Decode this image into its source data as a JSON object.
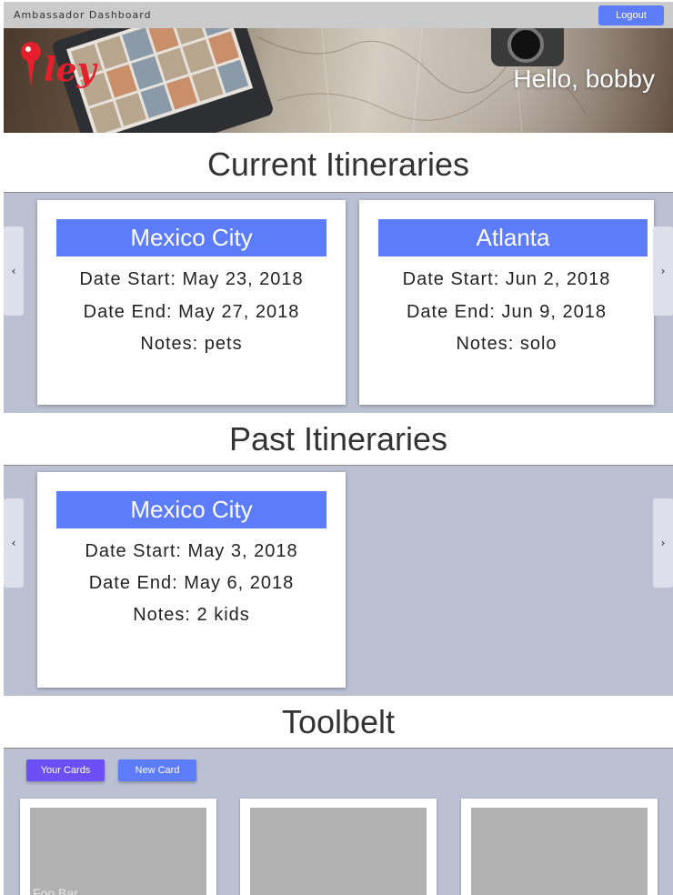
{
  "topbar": {
    "title": "Ambassador Dashboard",
    "logout_label": "Logout"
  },
  "hero": {
    "logo_text": "ley",
    "greeting": "Hello, bobby"
  },
  "sections": {
    "current_title": "Current Itineraries",
    "past_title": "Past Itineraries",
    "toolbelt_title": "Toolbelt"
  },
  "current_itineraries": [
    {
      "city": "Mexico City",
      "date_start": "Date Start: May 23, 2018",
      "date_end": "Date End: May 27, 2018",
      "notes": "Notes: pets"
    },
    {
      "city": "Atlanta",
      "date_start": "Date Start: Jun 2, 2018",
      "date_end": "Date End: Jun 9, 2018",
      "notes": "Notes: solo"
    }
  ],
  "past_itineraries": [
    {
      "city": "Mexico City",
      "date_start": "Date Start: May 3, 2018",
      "date_end": "Date End: May 6, 2018",
      "notes": "Notes: 2 kids"
    }
  ],
  "carousel": {
    "prev_glyph": "‹",
    "next_glyph": "›"
  },
  "toolbelt": {
    "your_cards_label": "Your Cards",
    "new_card_label": "New Card",
    "cards": [
      {
        "caption": "Foo Bar"
      },
      {
        "caption": ""
      },
      {
        "caption": ""
      }
    ]
  },
  "colors": {
    "accent": "#5c7cfa",
    "active_button": "#6c4ef5",
    "band": "#bbc1d3",
    "topbar": "#cbcbcb"
  }
}
